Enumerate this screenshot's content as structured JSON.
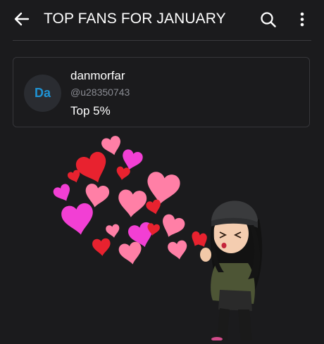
{
  "header": {
    "title": "TOP FANS FOR JANUARY",
    "back_icon": "arrow-left-icon",
    "search_icon": "search-icon",
    "more_icon": "more-vertical-icon"
  },
  "fan": {
    "avatar_initials": "Da",
    "name": "danmorfar",
    "handle": "@u28350743",
    "rank": "Top 5%"
  },
  "colors": {
    "background": "#1b1b1d",
    "accent": "#1f93d4",
    "muted_text": "#8a8c93",
    "heart_red": "#e8222f",
    "heart_pink": "#ff7fa6",
    "heart_magenta": "#f23fd4"
  }
}
